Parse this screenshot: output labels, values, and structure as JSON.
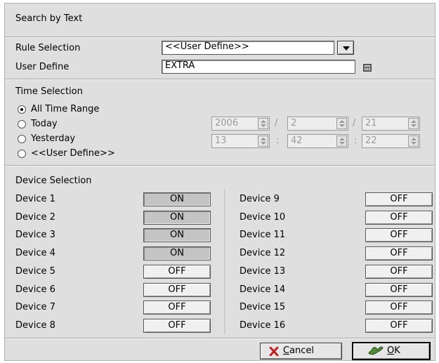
{
  "dialog": {
    "title": "Search by Text"
  },
  "rule": {
    "label": "Rule Selection",
    "selected": "<<User Define>>",
    "user_define_label": "User Define",
    "user_define_value": "EXTRA"
  },
  "time": {
    "title": "Time Selection",
    "options": [
      "All Time Range",
      "Today",
      "Yesterday",
      "<<User Define>>"
    ],
    "selected_index": 0,
    "date": {
      "year": "2006",
      "month": "2",
      "day": "21",
      "sep": "/"
    },
    "clock": {
      "hour": "13",
      "minute": "42",
      "second": "22",
      "sep": ":"
    }
  },
  "devices": {
    "title": "Device Selection",
    "left": [
      {
        "label": "Device 1",
        "state": "ON"
      },
      {
        "label": "Device 2",
        "state": "ON"
      },
      {
        "label": "Device 3",
        "state": "ON"
      },
      {
        "label": "Device 4",
        "state": "ON"
      },
      {
        "label": "Device 5",
        "state": "OFF"
      },
      {
        "label": "Device 6",
        "state": "OFF"
      },
      {
        "label": "Device 7",
        "state": "OFF"
      },
      {
        "label": "Device 8",
        "state": "OFF"
      }
    ],
    "right": [
      {
        "label": "Device 9",
        "state": "OFF"
      },
      {
        "label": "Device 10",
        "state": "OFF"
      },
      {
        "label": "Device 11",
        "state": "OFF"
      },
      {
        "label": "Device 12",
        "state": "OFF"
      },
      {
        "label": "Device 13",
        "state": "OFF"
      },
      {
        "label": "Device 14",
        "state": "OFF"
      },
      {
        "label": "Device 15",
        "state": "OFF"
      },
      {
        "label": "Device 16",
        "state": "OFF"
      }
    ]
  },
  "footer": {
    "cancel": {
      "mnemonic": "C",
      "rest": "ancel",
      "icon": "cancel-x-icon"
    },
    "ok": {
      "mnemonic": "O",
      "rest": "K",
      "icon": "ok-hand-icon"
    }
  },
  "colors": {
    "dialog_bg": "#dfdfdf",
    "toggle_on_bg": "#c4c4c4",
    "toggle_off_bg": "#f0f0f0",
    "disabled_text": "#9a9a9a"
  }
}
